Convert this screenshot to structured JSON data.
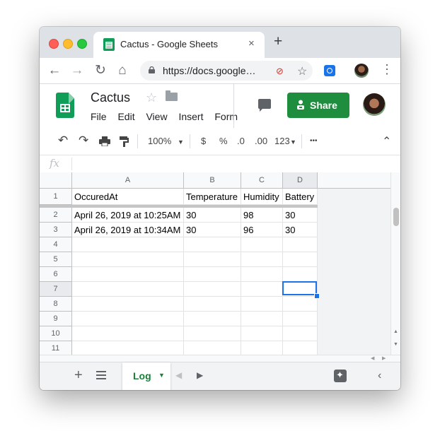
{
  "tab": {
    "title": "Cactus - Google Sheets",
    "favicon": "sheets-icon",
    "close": "×",
    "new_tab": "+"
  },
  "nav": {
    "back": "←",
    "forward": "→",
    "reload": "↻",
    "home": "⌂",
    "url": "https://docs.google.com/spreadsheets/d/...",
    "url_display": "https://docs.google…",
    "star": "☆",
    "kebab": "⋮"
  },
  "doc": {
    "title": "Cactus",
    "star": "☆",
    "menus": [
      "File",
      "Edit",
      "View",
      "Insert",
      "Form"
    ]
  },
  "share": {
    "label": "Share",
    "color": "#1e8e3e"
  },
  "toolbar": {
    "undo": "↶",
    "redo": "↷",
    "zoom": "100%",
    "currency": "$",
    "percent": "%",
    "dec_less": ".0",
    "dec_more": ".00",
    "format": "123",
    "more": "•••",
    "collapse": "⌃"
  },
  "formula": {
    "fx": "fx",
    "value": ""
  },
  "sheet": {
    "columns": [
      "A",
      "B",
      "C",
      "D"
    ],
    "rows": [
      {
        "num": "1",
        "cells": [
          "OccuredAt",
          "Temperature",
          "Humidity",
          "Battery"
        ]
      },
      {
        "num": "2",
        "cells": [
          "April 26, 2019 at 10:25AM",
          "30",
          "98",
          "30"
        ]
      },
      {
        "num": "3",
        "cells": [
          "April 26, 2019 at 10:34AM",
          "30",
          "96",
          "30"
        ]
      },
      {
        "num": "4",
        "cells": [
          "",
          "",
          "",
          ""
        ]
      },
      {
        "num": "5",
        "cells": [
          "",
          "",
          "",
          ""
        ]
      },
      {
        "num": "6",
        "cells": [
          "",
          "",
          "",
          ""
        ]
      },
      {
        "num": "7",
        "cells": [
          "",
          "",
          "",
          ""
        ]
      },
      {
        "num": "8",
        "cells": [
          "",
          "",
          "",
          ""
        ]
      },
      {
        "num": "9",
        "cells": [
          "",
          "",
          "",
          ""
        ]
      },
      {
        "num": "10",
        "cells": [
          "",
          "",
          "",
          ""
        ]
      },
      {
        "num": "11",
        "cells": [
          "",
          "",
          "",
          ""
        ]
      }
    ],
    "selected_cell": "D7",
    "selection_color": "#1a73e8"
  },
  "sheet_tabs": {
    "add": "+",
    "active": "Log",
    "active_color": "#188038"
  }
}
